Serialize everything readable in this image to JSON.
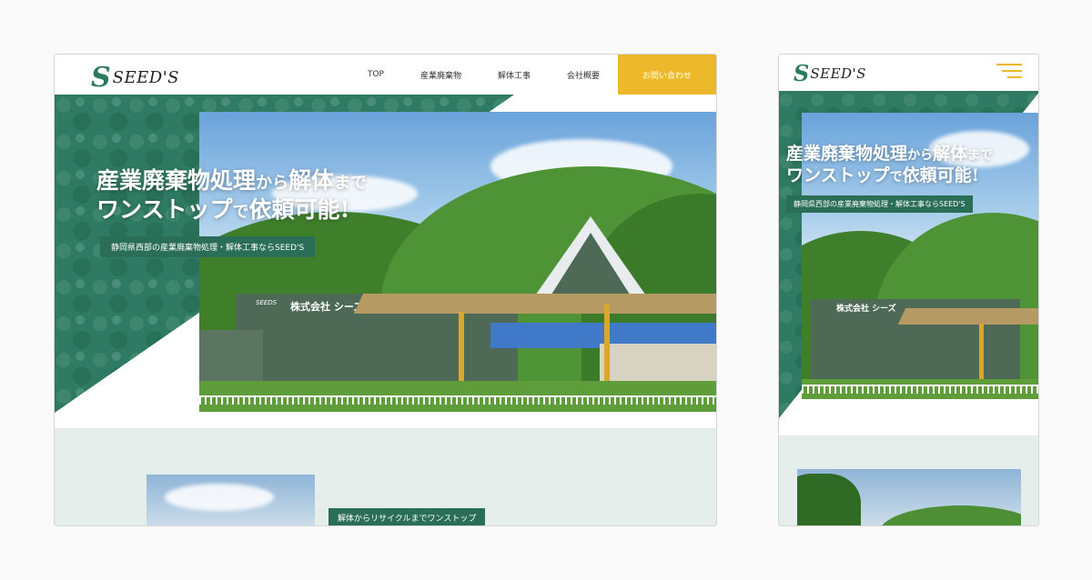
{
  "brand": {
    "logo_s": "S",
    "logo_text": "SEED'S"
  },
  "nav": {
    "items": [
      "TOP",
      "産業廃棄物",
      "解体工事",
      "会社概要"
    ],
    "cta": "お問い合わせ"
  },
  "hero": {
    "title_line1_big": "産業廃棄物処理",
    "title_line1_small": "から",
    "title_line1_big2": "解体",
    "title_line1_small2": "まで",
    "title_line2_big": "ワンストップ",
    "title_line2_small": "で",
    "title_line2_big2": "依頼可能!",
    "badge": "静岡県西部の産業廃棄物処理・解体工事ならSEED'S",
    "building_sign": "株式会社 シーズ",
    "building_logo": "SEEDS"
  },
  "section2": {
    "label": "解体からリサイクルまでワンストップ"
  },
  "icons": {
    "menu": "hamburger-menu-icon"
  },
  "colors": {
    "brand_green": "#2a6e58",
    "accent_yellow": "#edb92a",
    "section_bg": "#e6eeec"
  }
}
